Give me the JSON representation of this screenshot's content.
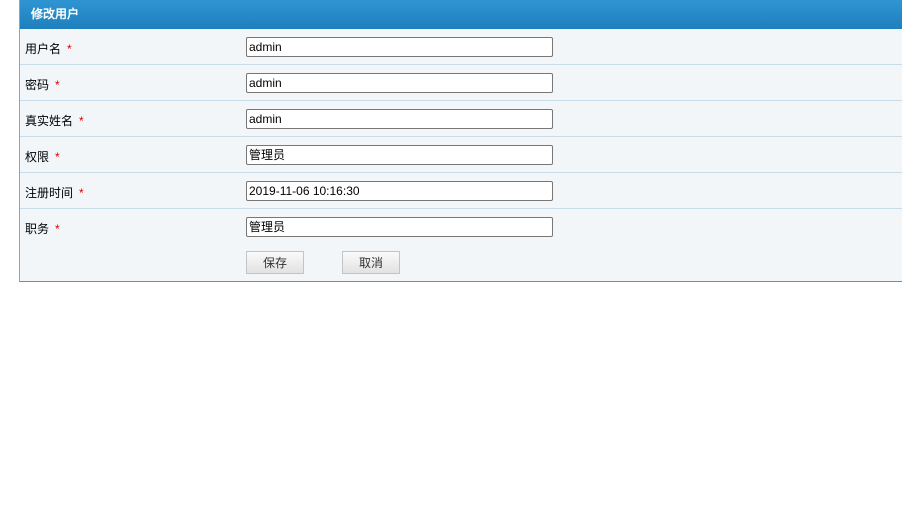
{
  "title": "修改用户",
  "fields": [
    {
      "label": "用户名",
      "value": "admin"
    },
    {
      "label": "密码",
      "value": "admin"
    },
    {
      "label": "真实姓名",
      "value": "admin"
    },
    {
      "label": "权限",
      "value": "管理员"
    },
    {
      "label": "注册时间",
      "value": "2019-11-06 10:16:30"
    },
    {
      "label": "职务",
      "value": "管理员"
    }
  ],
  "required_mark": "*",
  "save_label": "保存",
  "cancel_label": "取消"
}
